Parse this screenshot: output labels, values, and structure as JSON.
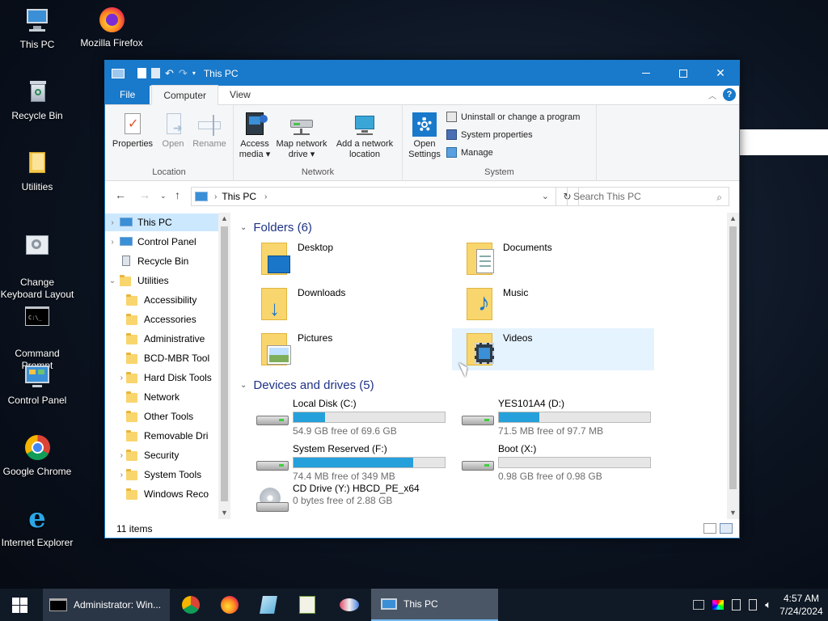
{
  "desktop": {
    "icons": [
      {
        "label": "This PC"
      },
      {
        "label": "Mozilla Firefox"
      },
      {
        "label": "Recycle Bin"
      },
      {
        "label": "Utilities"
      },
      {
        "label": "Change\nKeyboard Layout"
      },
      {
        "label": "Command\nPrompt"
      },
      {
        "label": "Control Panel"
      },
      {
        "label": "Google Chrome"
      },
      {
        "label": "Internet Explorer"
      }
    ]
  },
  "window": {
    "title": "This PC",
    "tabs": {
      "file": "File",
      "computer": "Computer",
      "view": "View"
    },
    "ribbon": {
      "location": {
        "label": "Location",
        "properties": "Properties",
        "open": "Open",
        "rename": "Rename"
      },
      "network": {
        "label": "Network",
        "access_media_1": "Access",
        "access_media_2": "media",
        "map_drive_1": "Map network",
        "map_drive_2": "drive",
        "add_location_1": "Add a network",
        "add_location_2": "location"
      },
      "system": {
        "label": "System",
        "open_settings_1": "Open",
        "open_settings_2": "Settings",
        "uninstall": "Uninstall or change a program",
        "system_properties": "System properties",
        "manage": "Manage"
      }
    },
    "address": {
      "path": "This PC",
      "search_placeholder": "Search This PC"
    },
    "nav": [
      {
        "label": "This PC"
      },
      {
        "label": "Control Panel"
      },
      {
        "label": "Recycle Bin"
      },
      {
        "label": "Utilities"
      },
      {
        "label": "Accessibility"
      },
      {
        "label": "Accessories"
      },
      {
        "label": "Administrative"
      },
      {
        "label": "BCD-MBR Tool"
      },
      {
        "label": "Hard Disk Tools"
      },
      {
        "label": "Network"
      },
      {
        "label": "Other Tools"
      },
      {
        "label": "Removable Dri"
      },
      {
        "label": "Security"
      },
      {
        "label": "System Tools"
      },
      {
        "label": "Windows Reco"
      }
    ],
    "folders_header": "Folders (6)",
    "folders": [
      {
        "name": "Desktop"
      },
      {
        "name": "Documents"
      },
      {
        "name": "Downloads"
      },
      {
        "name": "Music"
      },
      {
        "name": "Pictures"
      },
      {
        "name": "Videos"
      }
    ],
    "drives_header": "Devices and drives (5)",
    "drives": [
      {
        "name": "Local Disk (C:)",
        "free": "54.9 GB free of 69.6 GB",
        "used_fraction": 0.21
      },
      {
        "name": "YES101A4 (D:)",
        "free": "71.5 MB free of 97.7 MB",
        "used_fraction": 0.27
      },
      {
        "name": "System Reserved (F:)",
        "free": "74.4 MB free of 349 MB",
        "used_fraction": 0.79
      },
      {
        "name": "Boot (X:)",
        "free": "0.98 GB free of 0.98 GB",
        "used_fraction": 0.0
      },
      {
        "name": "CD Drive (Y:) HBCD_PE_x64",
        "free": "0 bytes free of 2.88 GB",
        "used_fraction": 1.0
      }
    ],
    "status": "11 items"
  },
  "taskbar": {
    "cmd_task": "Administrator: Win...",
    "explorer_task": "This PC",
    "time": "4:57 AM",
    "date": "7/24/2024"
  },
  "colors": {
    "accent": "#1979ca",
    "drive_fill": "#26a0da",
    "selection": "#cce8ff",
    "hover": "#e5f3ff"
  }
}
